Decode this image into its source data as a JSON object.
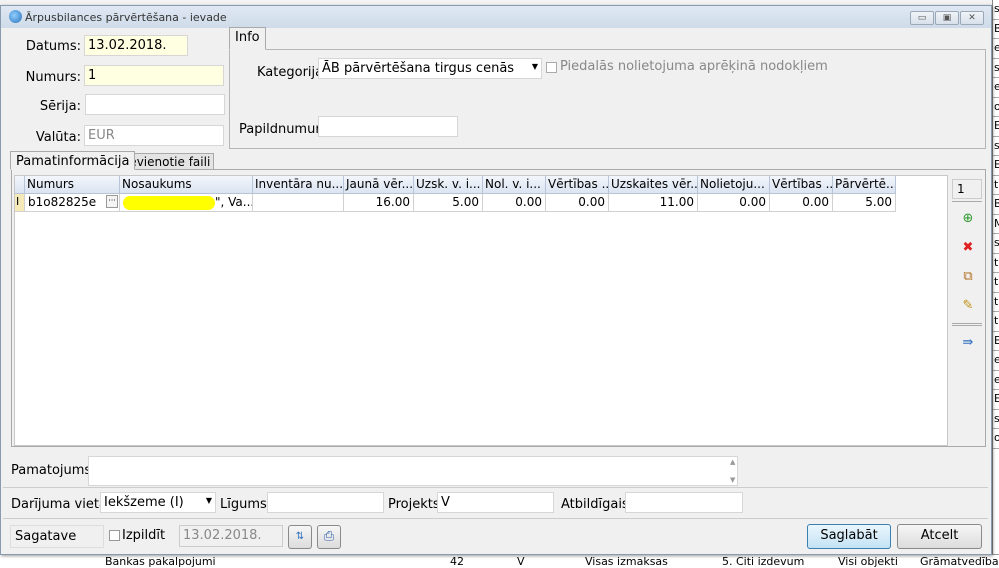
{
  "background": {
    "top_text": "...",
    "right_letters": [
      "s",
      "BĪ",
      "e",
      "se",
      "es",
      "od",
      "EK",
      "s",
      "EK",
      "t",
      "BĪ",
      "M",
      "s",
      "t",
      "t",
      "t",
      "t",
      "EK",
      "e",
      "es",
      "EK",
      "s",
      "od"
    ],
    "bottom_row": [
      "Bankas pakalpojumi",
      "42",
      "V",
      "Visas izmaksas",
      "5. Citi izdevum",
      "Visi objekti",
      "Grāmatvedības"
    ]
  },
  "window": {
    "title": "Ārpusbilances pārvērtēšana - ievade",
    "minimize": "▭",
    "maximize": "▣",
    "close": "✕"
  },
  "form": {
    "datums_label": "Datums:",
    "datums": "13.02.2018.",
    "numurs_label": "Numurs:",
    "numurs": "1",
    "serija_label": "Sērija:",
    "serija": "",
    "valuta_label": "Valūta:",
    "valuta": "EUR"
  },
  "info": {
    "tab": "Info",
    "kategorija_label": "Kategorija:",
    "kategorija": "ĀB pārvērtēšana tirgus cenās",
    "checkbox_label": "Piedalās nolietojuma aprēķinā nodokļiem",
    "papildnumurs_label": "Papildnumurs:",
    "papildnumurs": ""
  },
  "tabs": [
    "Pamatinformācija",
    "Pievienotie faili"
  ],
  "table": {
    "columns": [
      "Numurs",
      "Nosaukums",
      "Inventāra nu...",
      "Jaunā vēr...",
      "Uzsk. v. i...",
      "Nol. v. i...",
      "Vērtības ...",
      "Uzskaites vēr...",
      "Nolietoju...",
      "Vērtības ...",
      "Pārvērtē..."
    ],
    "rows": [
      [
        "b1o82825e",
        "\", Va...",
        "",
        "16.00",
        "5.00",
        "0.00",
        "0.00",
        "11.00",
        "0.00",
        "0.00",
        "5.00"
      ]
    ],
    "row_indicator": "I",
    "ellipsis": "···"
  },
  "toolbar": {
    "count": "1"
  },
  "bottom": {
    "pamatojums_label": "Pamatojums:",
    "pamatojums": "",
    "darijuma_label": "Darījuma vieta:",
    "darijuma": "Iekšzeme (I)",
    "ligums_label": "Līgums:",
    "ligums": "",
    "projekts_label": "Projekts:",
    "projekts": "V",
    "atbildigais_label": "Atbildīgais:",
    "atbildigais": "",
    "status": "Sagatave",
    "izpildit_label": "Izpildīt",
    "izpildit_date": "13.02.2018.",
    "save": "Saglabāt",
    "cancel": "Atcelt"
  }
}
